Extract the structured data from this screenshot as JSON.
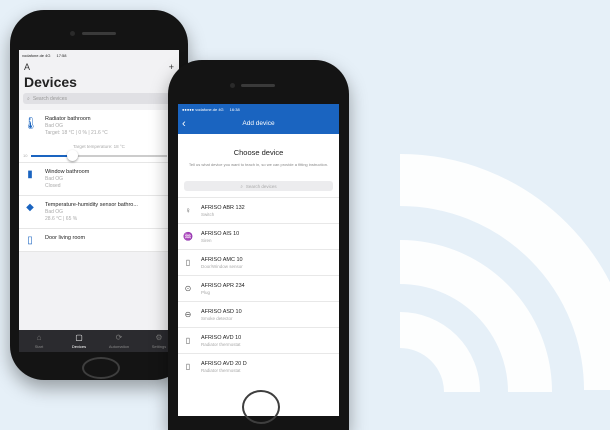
{
  "phone1": {
    "status": {
      "carrier": "vodafone.de 4G",
      "time": "17:58"
    },
    "top": {
      "left_icon": "A",
      "add": "+"
    },
    "title": "Devices",
    "search_placeholder": "Search devices",
    "radiator": {
      "name": "Radiator bathroom",
      "room": "Bad OG",
      "target": "Target: 18 °C | 0 % | 21.6 °C"
    },
    "slider": {
      "label": "Target temperature: 18 °C",
      "min": "10",
      "max": "30",
      "value_fraction": 0.3
    },
    "devices": [
      {
        "icon": "window-icon",
        "glyph": "▮",
        "name": "Window bathroom",
        "room": "Bad OG",
        "state": "Closed"
      },
      {
        "icon": "drop-icon",
        "glyph": "◆",
        "name": "Temperature-humidity sensor bathro...",
        "room": "Bad OG",
        "state": "28.6 °C | 65 %"
      },
      {
        "icon": "door-icon",
        "glyph": "▯",
        "name": "Door living room",
        "room": "",
        "state": ""
      }
    ],
    "tabs": [
      {
        "label": "Start",
        "glyph": "⌂",
        "active": false
      },
      {
        "label": "Devices",
        "glyph": "▢",
        "active": true
      },
      {
        "label": "Automation",
        "glyph": "⟳",
        "active": false
      },
      {
        "label": "Settings",
        "glyph": "⚙",
        "active": false
      }
    ]
  },
  "phone2": {
    "status": {
      "carrier": "●●●●● vodafone.de 4G",
      "time": "16:38"
    },
    "nav_title": "Add device",
    "back_glyph": "‹",
    "heading": "Choose device",
    "subheading": "Tell us what device you want to teach in, so we can provide a fitting instruction.",
    "search_placeholder": "Search devices",
    "products": [
      {
        "icon": "bulb-icon",
        "glyph": "♀",
        "name": "AFRISO ABR 132",
        "type": "Switch"
      },
      {
        "icon": "siren-icon",
        "glyph": "♒",
        "name": "AFRISO AIS 10",
        "type": "Siren"
      },
      {
        "icon": "window-sensor-icon",
        "glyph": "▯",
        "name": "AFRISO AMC 10",
        "type": "Door/Window sensor"
      },
      {
        "icon": "plug-icon",
        "glyph": "⊙",
        "name": "AFRISO APR 234",
        "type": "Plug"
      },
      {
        "icon": "smoke-icon",
        "glyph": "⊖",
        "name": "AFRISO ASD 10",
        "type": "Smoke detector"
      },
      {
        "icon": "thermostat-icon",
        "glyph": "▯",
        "name": "AFRISO AVD 10",
        "type": "Radiator thermostat"
      },
      {
        "icon": "thermostat-icon",
        "glyph": "▯",
        "name": "AFRISO AVD 20 D",
        "type": "Radiator thermostat"
      }
    ]
  }
}
